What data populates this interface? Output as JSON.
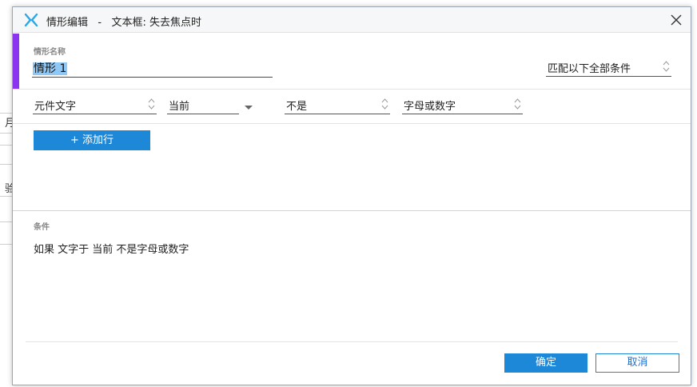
{
  "background": {
    "glyphs": [
      "月",
      "验"
    ]
  },
  "dialog": {
    "title": "情形编辑   -   文本框: 失去焦点时",
    "close_icon": "close-icon"
  },
  "case_name": {
    "label": "情形名称",
    "value": "情形 1",
    "match_mode": "匹配以下全部条件"
  },
  "condition_row": {
    "target": "元件文字",
    "scope": "当前",
    "operator": "不是",
    "value": "字母或数字"
  },
  "add_row_label": "+ 添加行",
  "conditions": {
    "label": "条件",
    "text": "如果 文字于 当前 不是字母或数字"
  },
  "footer": {
    "ok_label": "确定",
    "cancel_label": "取消"
  },
  "colors": {
    "accent": "#8b35f0",
    "primary": "#1e88d8"
  }
}
